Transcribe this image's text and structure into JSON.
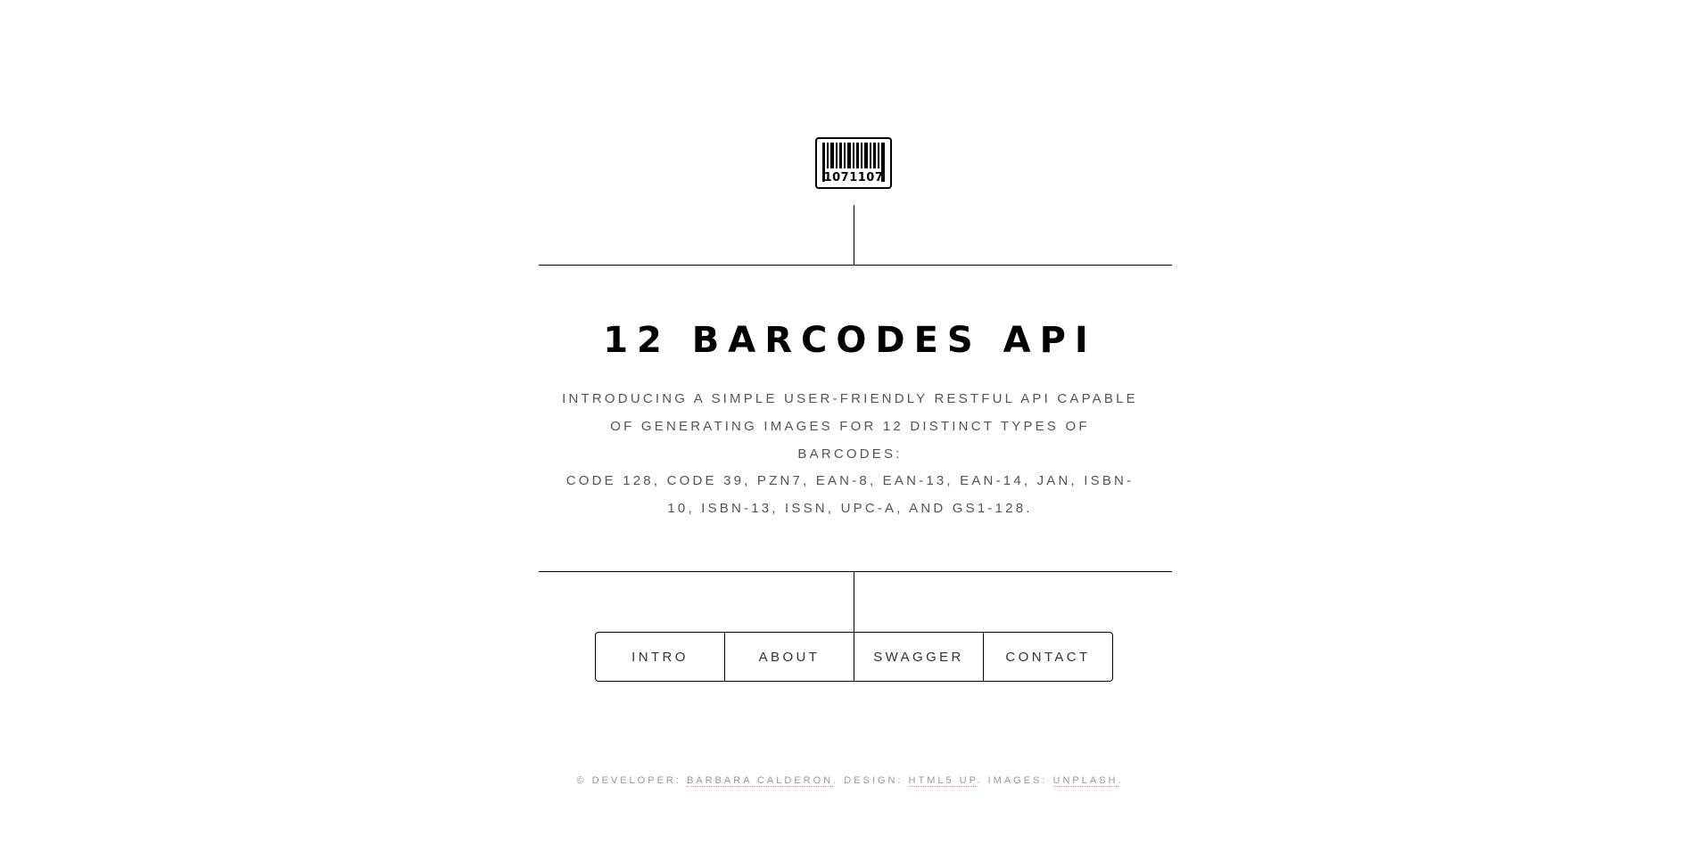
{
  "header": {
    "logo_icon": "barcode-icon",
    "logo_digits": "1071107"
  },
  "main": {
    "title": "12 BARCODES API",
    "intro": "INTRODUCING A SIMPLE USER-FRIENDLY RESTFUL API CAPABLE OF GENERATING IMAGES FOR 12 DISTINCT TYPES OF BARCODES:",
    "types": "CODE 128, CODE 39, PZN7, EAN-8, EAN-13, EAN-14, JAN, ISBN-10, ISBN-13, ISSN, UPC-A, AND GS1-128."
  },
  "nav": {
    "items": [
      {
        "label": "INTRO"
      },
      {
        "label": "ABOUT"
      },
      {
        "label": "SWAGGER"
      },
      {
        "label": "CONTACT"
      }
    ]
  },
  "footer": {
    "developer_prefix": "© DEVELOPER: ",
    "developer_name": "BARBARA CALDERON",
    "design_prefix": ". DESIGN: ",
    "design_link": "HTML5 UP",
    "images_prefix": ". IMAGES: ",
    "images_link": "UNPLASH",
    "suffix": "."
  },
  "colors": {
    "text": "#000000",
    "muted": "#555555",
    "footer": "#999999",
    "link_underline": "#f08a8a"
  }
}
